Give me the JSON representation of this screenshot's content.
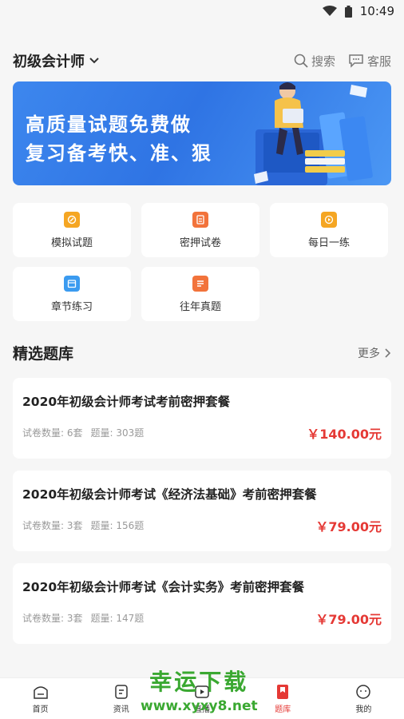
{
  "status_bar": {
    "time": "10:49"
  },
  "header": {
    "exam_name": "初级会计师",
    "search_label": "搜索",
    "service_label": "客服"
  },
  "banner": {
    "line1": "高质量试题免费做",
    "line2": "复习备考快、准、狠"
  },
  "tools": [
    {
      "label": "模拟试题",
      "color": "#f5a623"
    },
    {
      "label": "密押试卷",
      "color": "#f2733b"
    },
    {
      "label": "每日一练",
      "color": "#f5a623"
    },
    {
      "label": "章节练习",
      "color": "#3b9bf0"
    },
    {
      "label": "往年真题",
      "color": "#f2733b"
    }
  ],
  "section": {
    "title": "精选题库",
    "more": "更多"
  },
  "cards": [
    {
      "title": "2020年初级会计师考试考前密押套餐",
      "papers": "试卷数量: 6套",
      "questions": "题量: 303题",
      "price": "￥140.00元"
    },
    {
      "title": "2020年初级会计师考试《经济法基础》考前密押套餐",
      "papers": "试卷数量: 3套",
      "questions": "题量: 156题",
      "price": "￥79.00元"
    },
    {
      "title": "2020年初级会计师考试《会计实务》考前密押套餐",
      "papers": "试卷数量: 3套",
      "questions": "题量: 147题",
      "price": "￥79.00元"
    }
  ],
  "tabbar": [
    {
      "label": "首页",
      "icon": "home-icon"
    },
    {
      "label": "资讯",
      "icon": "news-icon"
    },
    {
      "label": "直播",
      "icon": "live-icon"
    },
    {
      "label": "题库",
      "icon": "question-bank-icon",
      "active": true
    },
    {
      "label": "我的",
      "icon": "profile-icon"
    }
  ],
  "watermark": {
    "title": "幸运下载",
    "url": "www.xyxy8.net"
  },
  "colors": {
    "accent": "#e53935",
    "banner": "#2f74e4"
  }
}
